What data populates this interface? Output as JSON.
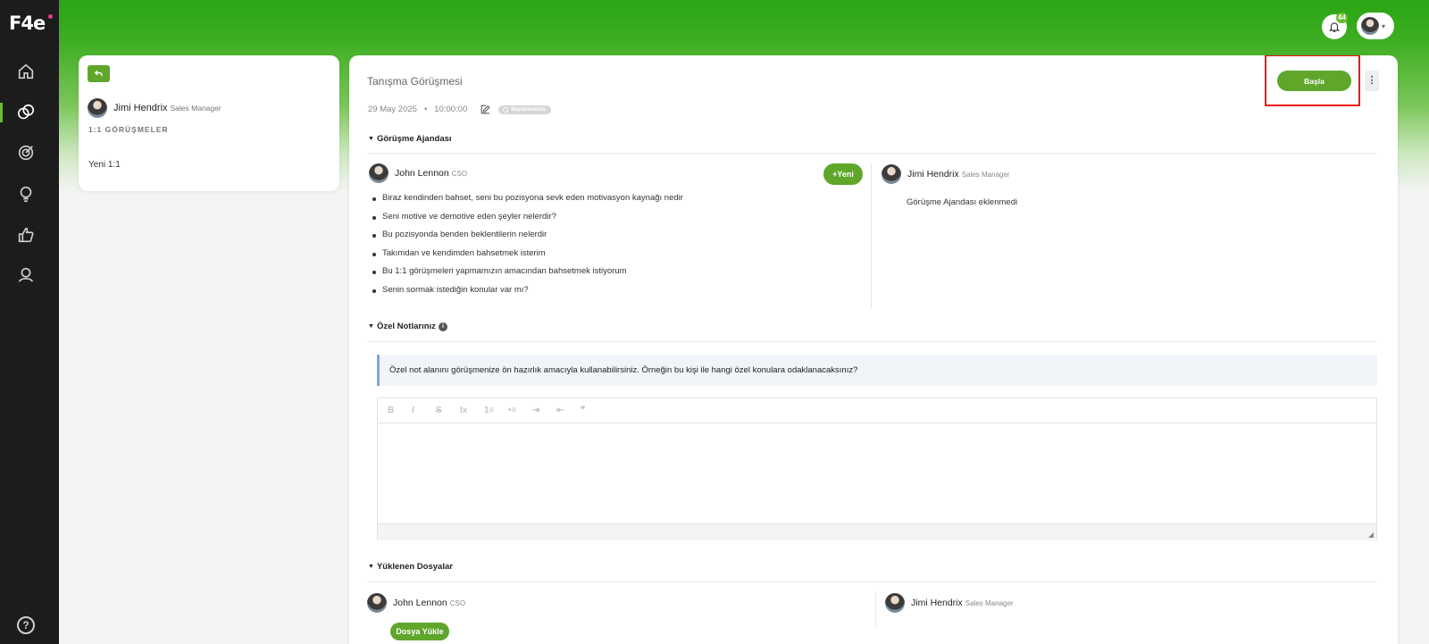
{
  "brand": {
    "logo_text": "F4e",
    "accent": "#5fa62a",
    "sidebar_bg": "#1c1c1c"
  },
  "sidebar": {
    "items": [
      {
        "icon": "home-icon"
      },
      {
        "icon": "one-on-one-icon",
        "active": true
      },
      {
        "icon": "target-icon"
      },
      {
        "icon": "lightbulb-icon"
      },
      {
        "icon": "thumbs-up-icon"
      },
      {
        "icon": "people-icon"
      }
    ],
    "help_label": "?"
  },
  "header": {
    "notification_count": "44"
  },
  "left_panel": {
    "user_name": "Jimi Hendrix",
    "user_role": "Sales Manager",
    "section_title": "1:1 GÖRÜŞMELER",
    "items": [
      "Yeni 1:1"
    ]
  },
  "meeting": {
    "title": "Tanışma Görüşmesi",
    "date": "29 May 2025",
    "separator": "•",
    "time": "10:00:00",
    "status": "Başlanmamış",
    "start_label": "Başla",
    "more_label": "⋮"
  },
  "agenda": {
    "section_title": "Görüşme Ajandası",
    "left_user": {
      "name": "John Lennon",
      "role": "CSO"
    },
    "right_user": {
      "name": "Jimi Hendrix",
      "role": "Sales Manager"
    },
    "new_label": "+Yeni",
    "items": [
      "Biraz kendinden bahset, seni bu pozisyona sevk eden motivasyon kaynağı nedir",
      "Seni motive ve demotive eden şeyler nelerdir?",
      "Bu pozisyonda benden beklentilerin nelerdir",
      "Takımdan ve kendimden bahsetmek isterim",
      "Bu 1:1 görüşmeleri yapmamızın amacından bahsetmek istiyorum",
      "Senin sormak istediğin konular var mı?"
    ],
    "right_empty": "Görüşme Ajandası eklenmedi"
  },
  "notes": {
    "section_title": "Özel Notlarınız",
    "info_icon": "i",
    "hint": "Özel not alanını görüşmenize ön hazırlık amacıyla kullanabilirsiniz. Örneğin bu kişi ile hangi özel konulara odaklanacaksınız?",
    "toolbar": [
      "B",
      "I",
      "S",
      "Ix",
      "1≡",
      "•≡",
      "⇥",
      "⇤",
      "❞"
    ]
  },
  "files": {
    "section_title": "Yüklenen Dosyalar",
    "left_user": {
      "name": "John Lennon",
      "role": "CSO"
    },
    "right_user": {
      "name": "Jimi Hendrix",
      "role": "Sales Manager"
    },
    "upload_label": "Dosya Yükle"
  }
}
